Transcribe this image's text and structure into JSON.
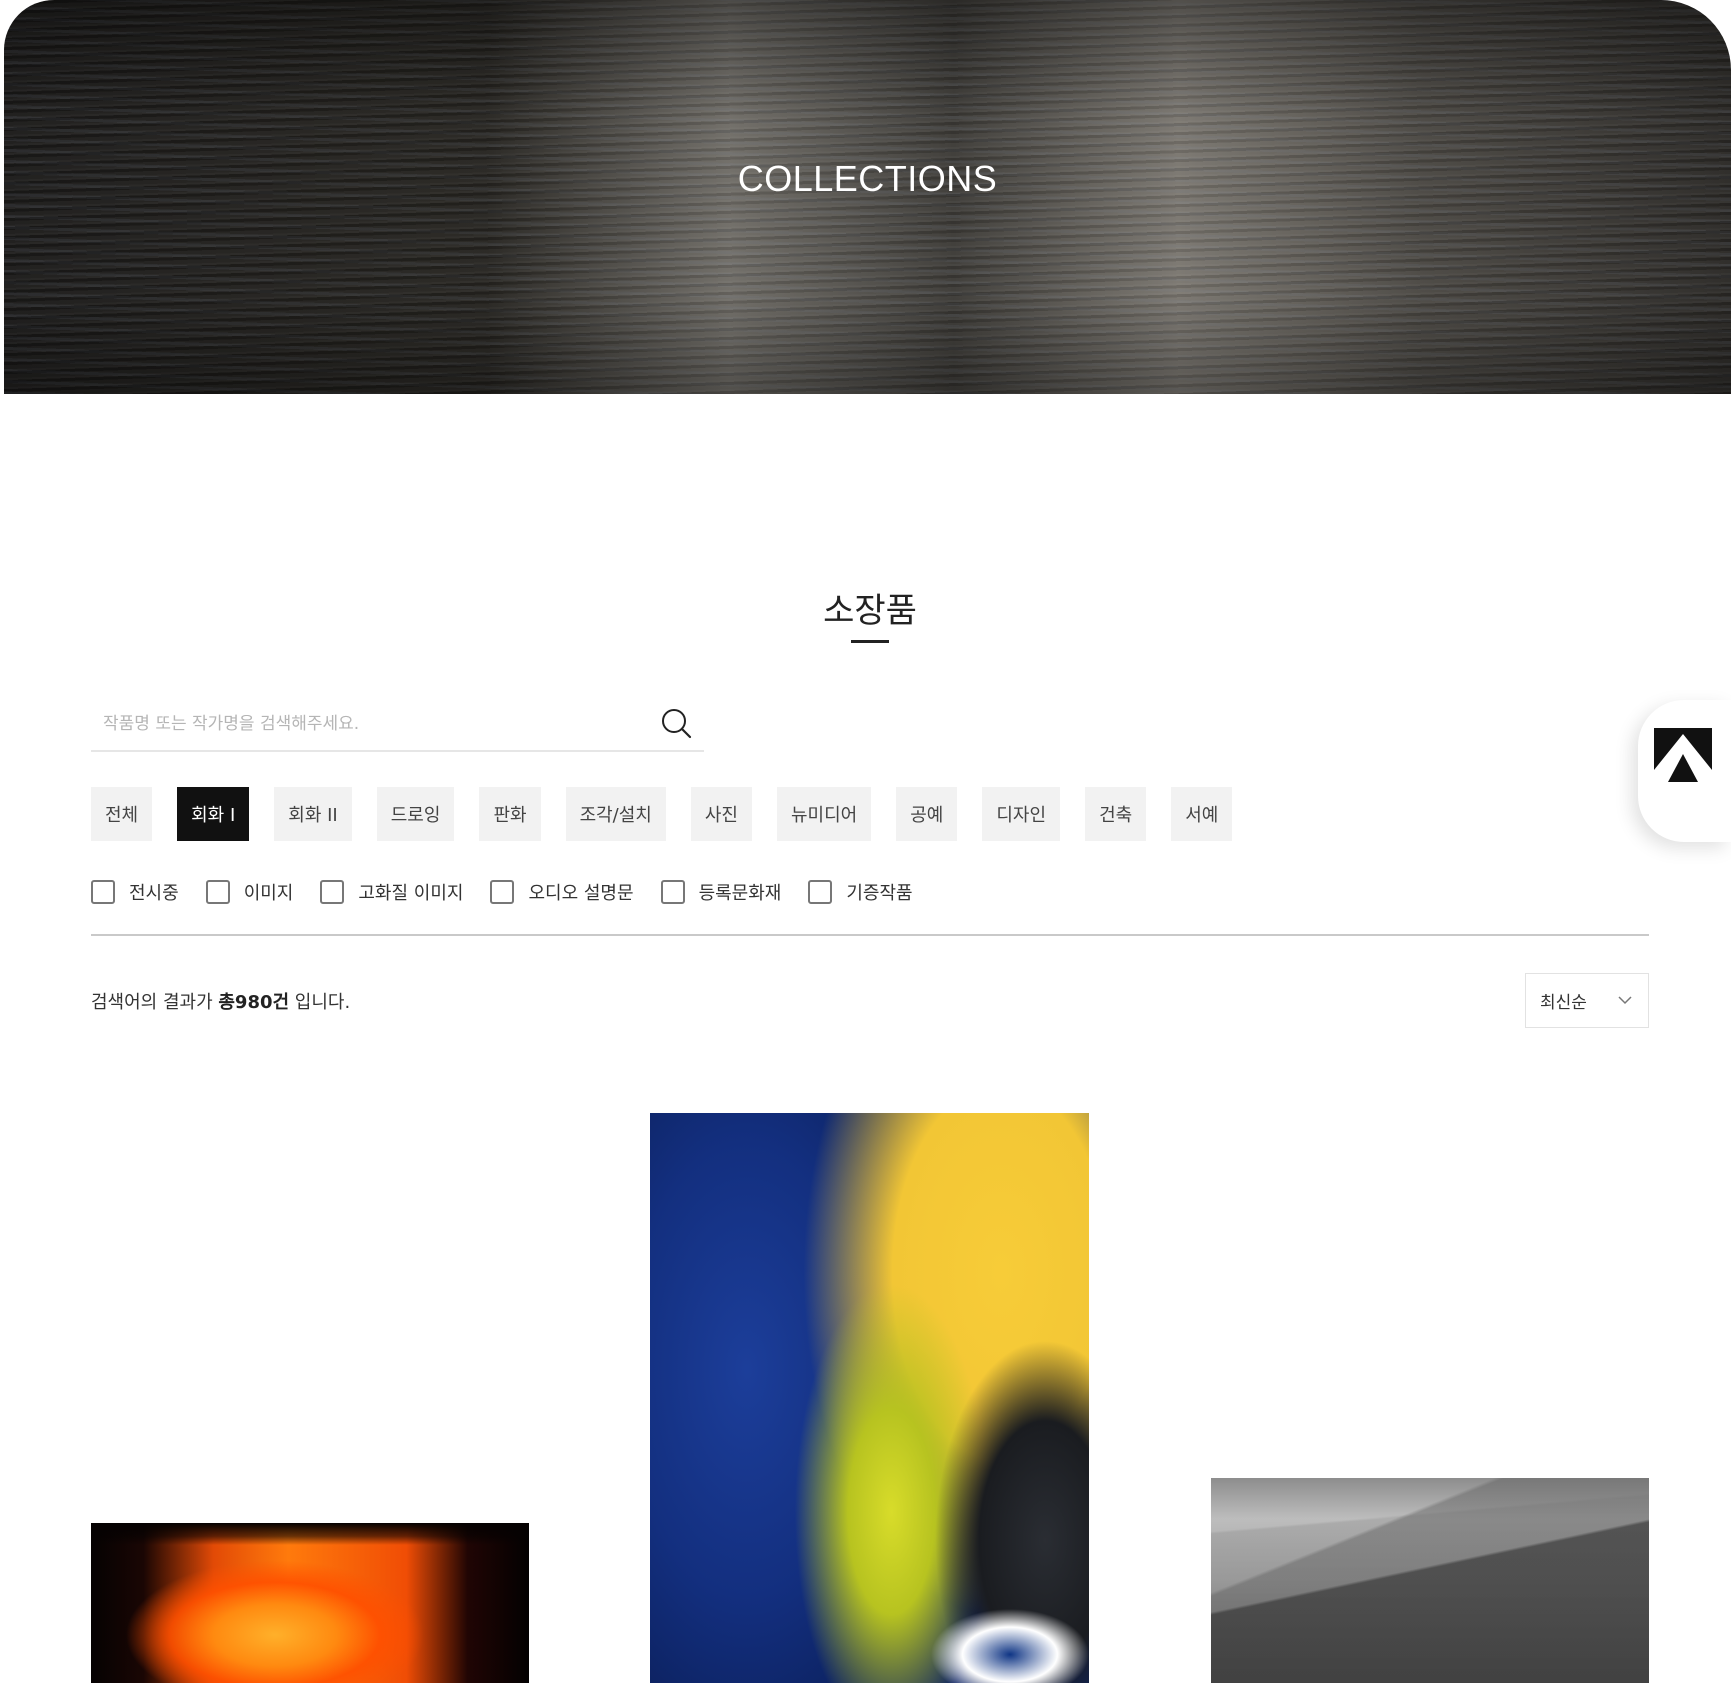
{
  "hero": {
    "title": "COLLECTIONS"
  },
  "section": {
    "title": "소장품"
  },
  "search": {
    "placeholder": "작품명 또는 작가명을 검색해주세요.",
    "value": "",
    "icon": "search-icon"
  },
  "categories": [
    {
      "label": "전체",
      "active": false
    },
    {
      "label": "회화 I",
      "active": true
    },
    {
      "label": "회화 II",
      "active": false
    },
    {
      "label": "드로잉",
      "active": false
    },
    {
      "label": "판화",
      "active": false
    },
    {
      "label": "조각/설치",
      "active": false
    },
    {
      "label": "사진",
      "active": false
    },
    {
      "label": "뉴미디어",
      "active": false
    },
    {
      "label": "공예",
      "active": false
    },
    {
      "label": "디자인",
      "active": false
    },
    {
      "label": "건축",
      "active": false
    },
    {
      "label": "서예",
      "active": false
    }
  ],
  "filters": [
    {
      "label": "전시중",
      "checked": false
    },
    {
      "label": "이미지",
      "checked": false
    },
    {
      "label": "고화질 이미지",
      "checked": false
    },
    {
      "label": "오디오 설명문",
      "checked": false
    },
    {
      "label": "등록문화재",
      "checked": false
    },
    {
      "label": "기증작품",
      "checked": false
    }
  ],
  "result": {
    "prefix": "검색어의 결과가 ",
    "total": "총980건",
    "suffix": " 입니다."
  },
  "sort": {
    "selected": "최신순",
    "icon": "chevron-down-icon"
  },
  "float_button": {
    "icon": "logo-icon"
  },
  "colors": {
    "active_category_bg": "#111111",
    "category_bg": "#f2f2f2",
    "divider": "#c9c9c9"
  }
}
